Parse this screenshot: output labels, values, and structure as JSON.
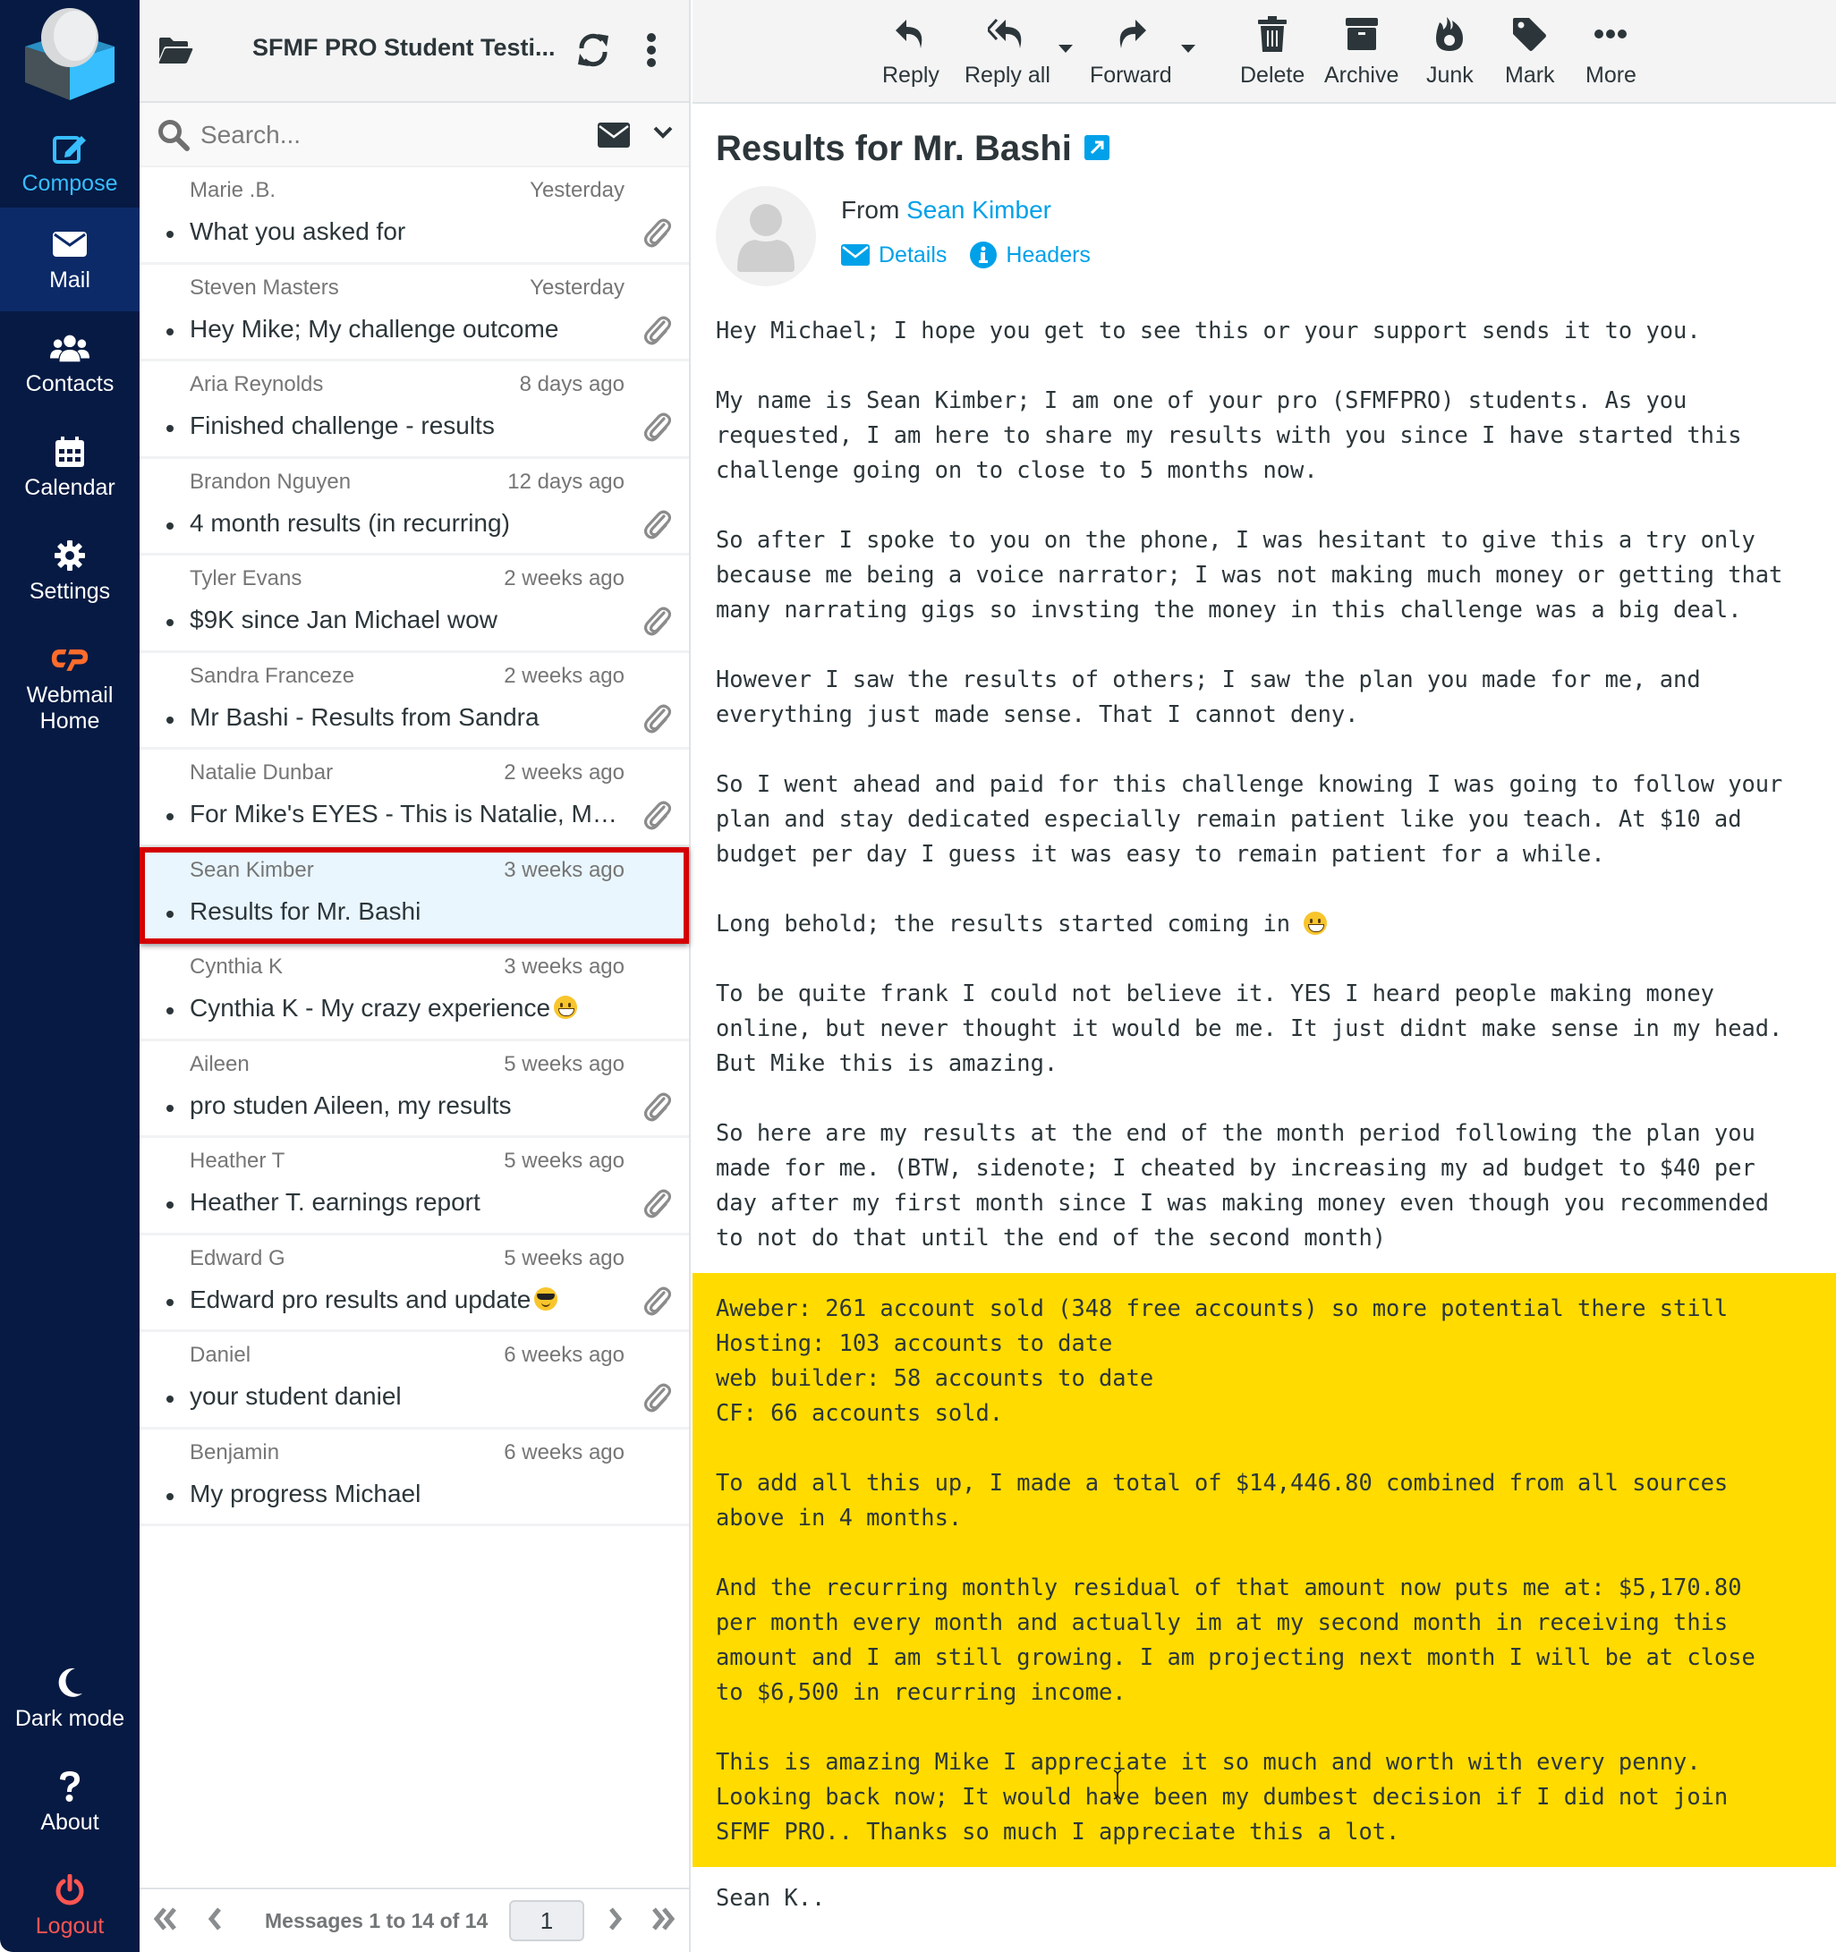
{
  "nav": {
    "compose": "Compose",
    "mail": "Mail",
    "contacts": "Contacts",
    "calendar": "Calendar",
    "settings": "Settings",
    "webmail_home_line1": "Webmail",
    "webmail_home_line2": "Home",
    "dark_mode": "Dark mode",
    "about": "About",
    "logout": "Logout"
  },
  "list": {
    "folder_title": "SFMF PRO Student Testi...",
    "search_placeholder": "Search...",
    "messages": [
      {
        "from": "Marie .B.",
        "date": "Yesterday",
        "subject": "What you asked for",
        "attachment": true
      },
      {
        "from": "Steven Masters",
        "date": "Yesterday",
        "subject": "Hey Mike; My challenge outcome",
        "attachment": true
      },
      {
        "from": "Aria Reynolds",
        "date": "8 days ago",
        "subject": "Finished challenge - results",
        "attachment": true
      },
      {
        "from": "Brandon Nguyen",
        "date": "12 days ago",
        "subject": "4 month results (in recurring)",
        "attachment": true
      },
      {
        "from": "Tyler Evans",
        "date": "2 weeks ago",
        "subject": "$9K since Jan Michael wow",
        "attachment": true
      },
      {
        "from": "Sandra Franceze",
        "date": "2 weeks ago",
        "subject": "Mr Bashi - Results from Sandra",
        "attachment": true
      },
      {
        "from": "Natalie Dunbar",
        "date": "2 weeks ago",
        "subject": "For Mike's EYES - This is Natalie, My ...",
        "attachment": true
      },
      {
        "from": "Sean Kimber",
        "date": "3 weeks ago",
        "subject": "Results for Mr. Bashi",
        "attachment": false,
        "selected": true
      },
      {
        "from": "Cynthia K",
        "date": "3 weeks ago",
        "subject": "Cynthia K - My crazy experience",
        "emoji": "grinning-face",
        "attachment": false
      },
      {
        "from": "Aileen",
        "date": "5 weeks ago",
        "subject": "pro studen Aileen, my results",
        "attachment": true
      },
      {
        "from": "Heather T",
        "date": "5 weeks ago",
        "subject": "Heather T. earnings report",
        "attachment": true
      },
      {
        "from": "Edward G",
        "date": "5 weeks ago",
        "subject": "Edward pro results and update",
        "emoji": "sunglasses-face",
        "attachment": true
      },
      {
        "from": "Daniel",
        "date": "6 weeks ago",
        "subject": "your student daniel",
        "attachment": true
      },
      {
        "from": "Benjamin",
        "date": "6 weeks ago",
        "subject": "My progress Michael",
        "attachment": false
      }
    ],
    "pager": {
      "count_text": "Messages 1 to 14 of 14",
      "page": "1"
    }
  },
  "toolbar": {
    "reply": "Reply",
    "reply_all": "Reply all",
    "forward": "Forward",
    "delete": "Delete",
    "archive": "Archive",
    "junk": "Junk",
    "mark": "Mark",
    "more": "More"
  },
  "message": {
    "subject": "Results for Mr. Bashi",
    "from_label": "From",
    "from_name": "Sean Kimber",
    "details_label": "Details",
    "headers_label": "Headers",
    "body": {
      "p1": "Hey Michael; I hope you get to see this or your support sends it to you.",
      "p2": "My name is Sean Kimber; I am one of your pro (SFMFPRO) students. As you\nrequested, I am here to share my results with you since I have started this\nchallenge going on to close to 5 months now.",
      "p3": "So after I spoke to you on the phone, I was hesitant to give this a try only\nbecause me being a voice narrator; I was not making much money or getting that\nmany narrating gigs so invsting the money in this challenge was a big deal.",
      "p4": "However I saw the results of others; I saw the plan you made for me, and\neverything just made sense. That I cannot deny.",
      "p5": "So I went ahead and paid for this challenge knowing I was going to follow your\nplan and stay dedicated especially remain patient like you teach. At $10 ad\nbudget per day I guess it was easy to remain patient for a while.",
      "p6": "Long behold; the results started coming in ",
      "p7": "To be quite frank I could not believe it. YES I heard people making money\nonline, but never thought it would be me. It just didnt make sense in my head.\nBut Mike this is amazing.",
      "p8": "So here are my results at the end of the month period following the plan you\nmade for me. (BTW, sidenote; I cheated by increasing my ad budget to $40 per\nday after my first month since I was making money even though you recommended\nto not do that until the end of the second month)",
      "hl1": "Aweber: 261 account sold (348 free accounts) so more potential there still\nHosting: 103 accounts to date\nweb builder: 58 accounts to date\nCF: 66 accounts sold.",
      "hl2": "To add all this up, I made a total of $14,446.80 combined from all sources\nabove in 4 months.",
      "hl3": "And the recurring monthly residual of that amount now puts me at: $5,170.80\nper month every month and actually im at my second month in receiving this\namount and I am still growing. I am projecting next month I will be at close\nto $6,500 in recurring income.",
      "hl4": "This is amazing Mike I appreciate it so much and worth with every penny.\nLooking back now; It would have been my dumbest decision if I did not join\nSFMF PRO.. Thanks so much I appreciate this a lot.",
      "signature": "Sean K.."
    }
  },
  "colors": {
    "nav_bg": "#061a43",
    "nav_active": "#0c2a68",
    "accent": "#37beff",
    "link": "#00a1e9",
    "logout": "#ff5552",
    "highlight": "#ffdb00",
    "selected_row_bg": "#e9f6fe",
    "selected_row_border": "#d40000"
  }
}
